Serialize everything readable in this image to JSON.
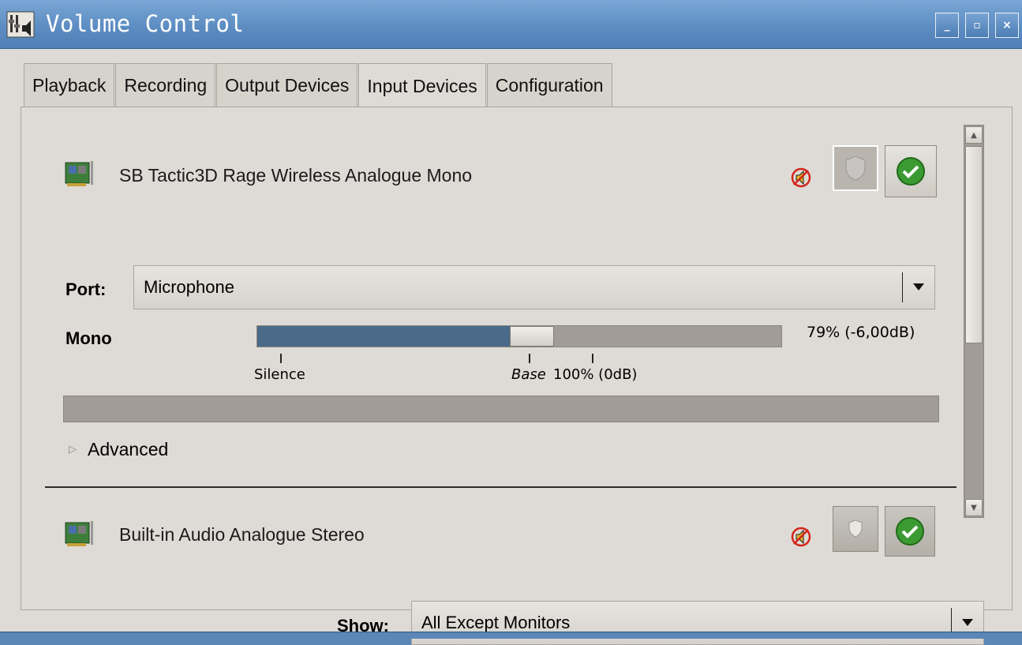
{
  "window": {
    "title": "Volume Control",
    "buttons": {
      "minimize": "_",
      "maximize": "▫",
      "close": "×"
    }
  },
  "tabs": [
    {
      "label": "Playback",
      "active": false
    },
    {
      "label": "Recording",
      "active": false
    },
    {
      "label": "Output Devices",
      "active": false
    },
    {
      "label": "Input Devices",
      "active": true
    },
    {
      "label": "Configuration",
      "active": false
    }
  ],
  "devices": [
    {
      "name": "SB Tactic3D Rage Wireless Analogue Mono",
      "icon": "sound-card-icon",
      "port_label": "Port:",
      "port_value": "Microphone",
      "channel_label": "Mono",
      "volume_percent_text": "79% (-6,00dB)",
      "volume_fraction": 0.79,
      "ticks": {
        "silence": "Silence",
        "base": "Base",
        "hundred": "100% (0dB)"
      },
      "advanced_label": "Advanced"
    },
    {
      "name": "Built-in Audio Analogue Stereo",
      "icon": "sound-card-icon"
    }
  ],
  "show": {
    "label": "Show:",
    "value": "All Except Monitors"
  },
  "colors": {
    "titlebar": "#5d8dc2",
    "window_bg": "#dedbd6",
    "slider_fill": "#4b6a89",
    "trough": "#a19d96"
  }
}
